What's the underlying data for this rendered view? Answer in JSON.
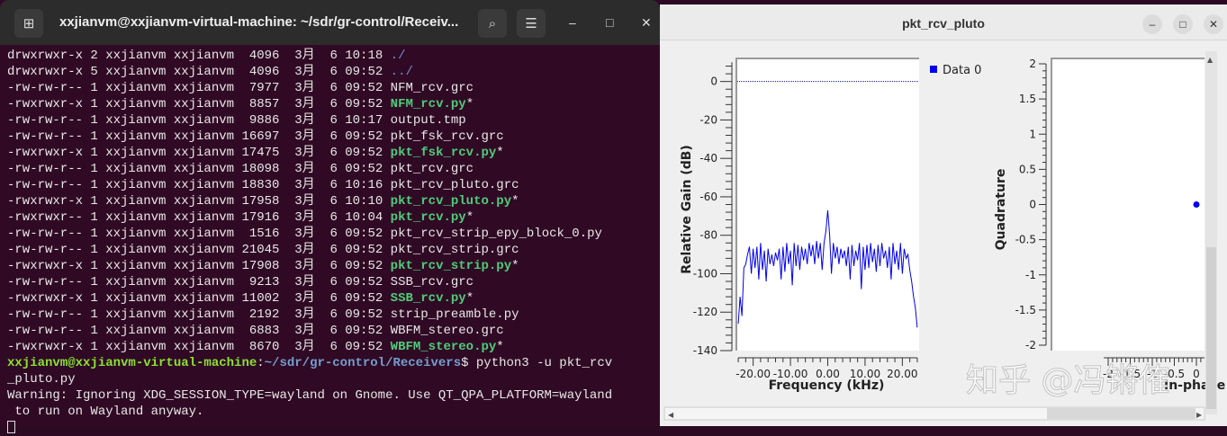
{
  "terminal": {
    "title": "xxjianvm@xxjianvm-virtual-machine: ~/sdr/gr-control/Receiv...",
    "new_tab_icon": "new-tab-icon",
    "search_icon": "search-icon",
    "menu_icon": "hamburger-menu-icon",
    "minimize": "–",
    "maximize": "□",
    "close": "✕",
    "listing": [
      {
        "prefix": "drwxrwxr-x 2 xxjianvm xxjianvm  4096  3月  6 10:18 ",
        "name": "./",
        "kind": "dir"
      },
      {
        "prefix": "drwxrwxr-x 5 xxjianvm xxjianvm  4096  3月  6 09:52 ",
        "name": "../",
        "kind": "dir"
      },
      {
        "prefix": "-rw-rw-r-- 1 xxjianvm xxjianvm  7977  3月  6 09:52 ",
        "name": "NFM_rcv.grc",
        "kind": "file"
      },
      {
        "prefix": "-rwxrwxr-x 1 xxjianvm xxjianvm  8857  3月  6 09:52 ",
        "name": "NFM_rcv.py",
        "kind": "exec"
      },
      {
        "prefix": "-rw-rw-r-- 1 xxjianvm xxjianvm  9886  3月  6 10:17 ",
        "name": "output.tmp",
        "kind": "file"
      },
      {
        "prefix": "-rw-rw-r-- 1 xxjianvm xxjianvm 16697  3月  6 09:52 ",
        "name": "pkt_fsk_rcv.grc",
        "kind": "file"
      },
      {
        "prefix": "-rwxrwxr-x 1 xxjianvm xxjianvm 17475  3月  6 09:52 ",
        "name": "pkt_fsk_rcv.py",
        "kind": "exec"
      },
      {
        "prefix": "-rw-rw-r-- 1 xxjianvm xxjianvm 18098  3月  6 09:52 ",
        "name": "pkt_rcv.grc",
        "kind": "file"
      },
      {
        "prefix": "-rw-rw-r-- 1 xxjianvm xxjianvm 18830  3月  6 10:16 ",
        "name": "pkt_rcv_pluto.grc",
        "kind": "file"
      },
      {
        "prefix": "-rwxrwxr-x 1 xxjianvm xxjianvm 17958  3月  6 10:10 ",
        "name": "pkt_rcv_pluto.py",
        "kind": "exec"
      },
      {
        "prefix": "-rwxrwxr-- 1 xxjianvm xxjianvm 17916  3月  6 10:04 ",
        "name": "pkt_rcv.py",
        "kind": "exec"
      },
      {
        "prefix": "-rw-rw-r-- 1 xxjianvm xxjianvm  1516  3月  6 09:52 ",
        "name": "pkt_rcv_strip_epy_block_0.py",
        "kind": "file"
      },
      {
        "prefix": "-rw-rw-r-- 1 xxjianvm xxjianvm 21045  3月  6 09:52 ",
        "name": "pkt_rcv_strip.grc",
        "kind": "file"
      },
      {
        "prefix": "-rwxrwxr-x 1 xxjianvm xxjianvm 17908  3月  6 09:52 ",
        "name": "pkt_rcv_strip.py",
        "kind": "exec"
      },
      {
        "prefix": "-rw-rw-r-- 1 xxjianvm xxjianvm  9213  3月  6 09:52 ",
        "name": "SSB_rcv.grc",
        "kind": "file"
      },
      {
        "prefix": "-rwxrwxr-x 1 xxjianvm xxjianvm 11002  3月  6 09:52 ",
        "name": "SSB_rcv.py",
        "kind": "exec"
      },
      {
        "prefix": "-rw-rw-r-- 1 xxjianvm xxjianvm  2192  3月  6 09:52 ",
        "name": "strip_preamble.py",
        "kind": "file"
      },
      {
        "prefix": "-rw-rw-r-- 1 xxjianvm xxjianvm  6883  3月  6 09:52 ",
        "name": "WBFM_stereo.grc",
        "kind": "file"
      },
      {
        "prefix": "-rwxrwxr-x 1 xxjianvm xxjianvm  8670  3月  6 09:52 ",
        "name": "WBFM_stereo.py",
        "kind": "exec"
      }
    ],
    "exec_suffix": "*",
    "prompt_user": "xxjianvm@xxjianvm-virtual-machine",
    "prompt_sep": ":",
    "prompt_path": "~/sdr/gr-control/Receivers",
    "prompt_cmd": "$ python3 -u pkt_rcv",
    "prompt_cmd_wrap": "_pluto.py",
    "warning_1": "Warning: Ignoring XDG_SESSION_TYPE=wayland on Gnome. Use QT_QPA_PLATFORM=wayland",
    "warning_2": " to run on Wayland anyway."
  },
  "window": {
    "title": "pkt_rcv_pluto",
    "minimize": "–",
    "maximize": "□",
    "close": "✕"
  },
  "watermark": "知乎 @冯锵傕",
  "colors": {
    "trace": "#0000ee",
    "terminal_bg": "#300a24"
  },
  "chart_data": [
    {
      "type": "line",
      "title": "",
      "xlabel": "Frequency (kHz)",
      "ylabel": "Relative Gain (dB)",
      "xlim": [
        -24.5,
        24.5
      ],
      "ylim": [
        -140,
        12
      ],
      "xticks": [
        "-20.00",
        "-10.00",
        "0.00",
        "10.00",
        "20.00"
      ],
      "xtick_values": [
        -20,
        -10,
        0,
        10,
        20
      ],
      "yticks": [
        "0",
        "-20",
        "-40",
        "-60",
        "-80",
        "-100",
        "-120",
        "-140"
      ],
      "ytick_values": [
        0,
        -20,
        -40,
        -60,
        -80,
        -100,
        -120,
        -140
      ],
      "reference_line_db": 0,
      "legend": [
        "Data 0"
      ],
      "legend_placement": "right",
      "x_start": -24,
      "x_step": 0.5,
      "values": [
        -126,
        -112,
        -122,
        -97,
        -95,
        -90,
        -86,
        -100,
        -87,
        -97,
        -86,
        -103,
        -84,
        -98,
        -88,
        -104,
        -87,
        -95,
        -90,
        -96,
        -89,
        -93,
        -87,
        -103,
        -86,
        -99,
        -84,
        -95,
        -88,
        -106,
        -84,
        -96,
        -85,
        -98,
        -86,
        -93,
        -87,
        -95,
        -84,
        -91,
        -85,
        -95,
        -83,
        -92,
        -84,
        -98,
        -84,
        -78,
        -67,
        -80,
        -100,
        -84,
        -92,
        -86,
        -95,
        -87,
        -92,
        -88,
        -96,
        -86,
        -103,
        -85,
        -96,
        -88,
        -93,
        -84,
        -108,
        -86,
        -98,
        -85,
        -97,
        -84,
        -94,
        -87,
        -99,
        -85,
        -96,
        -84,
        -92,
        -88,
        -97,
        -86,
        -103,
        -84,
        -95,
        -88,
        -98,
        -84,
        -100,
        -87,
        -92,
        -90,
        -98,
        -104,
        -112,
        -118,
        -128
      ]
    },
    {
      "type": "scatter",
      "title": "",
      "xlabel": "In-phase",
      "ylabel": "Quadrature",
      "ylim": [
        -2,
        2
      ],
      "yticks": [
        "2",
        "1.5",
        "1",
        "0.5",
        "0",
        "-0.5",
        "-1",
        "-1.5",
        "-2"
      ],
      "ytick_values": [
        2,
        1.5,
        1,
        0.5,
        0,
        -0.5,
        -1,
        -1.5,
        -2
      ],
      "xticks": [
        "-2",
        "-1.5",
        "-1",
        "-0.5",
        "0"
      ],
      "xtick_values": [
        -2,
        -1.5,
        -1,
        -0.5,
        0
      ],
      "points": [
        [
          0,
          0
        ]
      ]
    }
  ]
}
